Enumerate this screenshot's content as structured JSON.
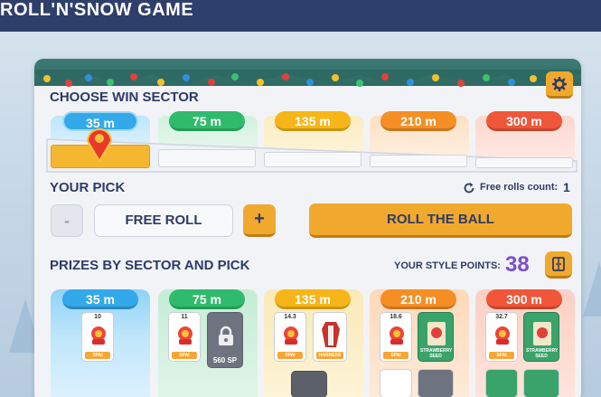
{
  "header": {
    "title": "ROLL'N'SNOW GAME"
  },
  "colors": {
    "accent_orange": "#f1a92d",
    "navy": "#2d3b66",
    "purple_points": "#7b4fc9",
    "sector_blue": "#33a9ea",
    "sector_green": "#2fbb6b",
    "sector_yellow": "#f6b619",
    "sector_orange": "#f58f25",
    "sector_red": "#f0563a"
  },
  "settings": {
    "icon": "gear-icon"
  },
  "choose_sector": {
    "title": "CHOOSE WIN SECTOR",
    "sectors": [
      {
        "label": "35 m",
        "selected": true
      },
      {
        "label": "75 m"
      },
      {
        "label": "135 m"
      },
      {
        "label": "210 m"
      },
      {
        "label": "300 m"
      }
    ]
  },
  "pick": {
    "title": "YOUR PICK",
    "free_rolls_label": "Free rolls count:",
    "free_rolls_count": "1",
    "minus_label": "-",
    "plus_label": "+",
    "value": "FREE ROLL",
    "roll_button": "ROLL THE BALL"
  },
  "prizes": {
    "title": "PRIZES BY SECTOR AND PICK",
    "style_points_label": "YOUR STYLE POINTS:",
    "style_points_value": "38",
    "sectors": [
      {
        "label": "35 m",
        "cards": [
          {
            "type": "spai",
            "level": "10",
            "tag": "SPAI"
          }
        ]
      },
      {
        "label": "75 m",
        "cards": [
          {
            "type": "spai",
            "level": "11",
            "tag": "SPAI"
          },
          {
            "type": "locked",
            "price": "560 SP"
          }
        ]
      },
      {
        "label": "135 m",
        "cards": [
          {
            "type": "spai",
            "level": "14.3",
            "tag": "SPAI"
          },
          {
            "type": "harness",
            "tag": "HARNESS"
          }
        ]
      },
      {
        "label": "210 m",
        "cards": [
          {
            "type": "spai",
            "level": "18.6",
            "tag": "SPAI"
          },
          {
            "type": "seed",
            "tag": "STRAWBERRY SEED"
          }
        ]
      },
      {
        "label": "300 m",
        "cards": [
          {
            "type": "spai",
            "level": "32.7",
            "tag": "SPAI"
          },
          {
            "type": "seed",
            "tag": "STRAWBERRY SEED"
          }
        ]
      }
    ]
  }
}
